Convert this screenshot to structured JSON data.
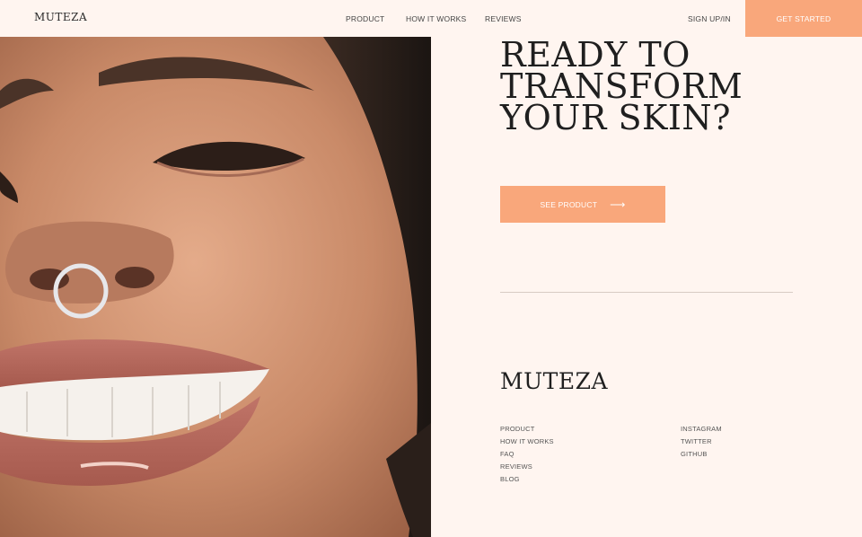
{
  "header": {
    "logo": "MUTEZA",
    "nav": [
      "PRODUCT",
      "HOW IT WORKS",
      "REVIEWS"
    ],
    "sign_in": "SIGN UP/IN",
    "cta": "GET STARTED"
  },
  "hero": {
    "headline_lines": [
      "READY TO",
      "TRANSFORM",
      "YOUR SKIN?"
    ],
    "button": "SEE PRODUCT",
    "button_icon": "arrow-right-icon"
  },
  "footer": {
    "logo": "MUTEZA",
    "links_left": [
      "PRODUCT",
      "HOW IT WORKS",
      "FAQ",
      "REVIEWS",
      "BLOG"
    ],
    "links_right": [
      "INSTAGRAM",
      "TWITTER",
      "GITHUB"
    ]
  },
  "colors": {
    "background": "#fff5f0",
    "accent": "#f9a77b"
  }
}
